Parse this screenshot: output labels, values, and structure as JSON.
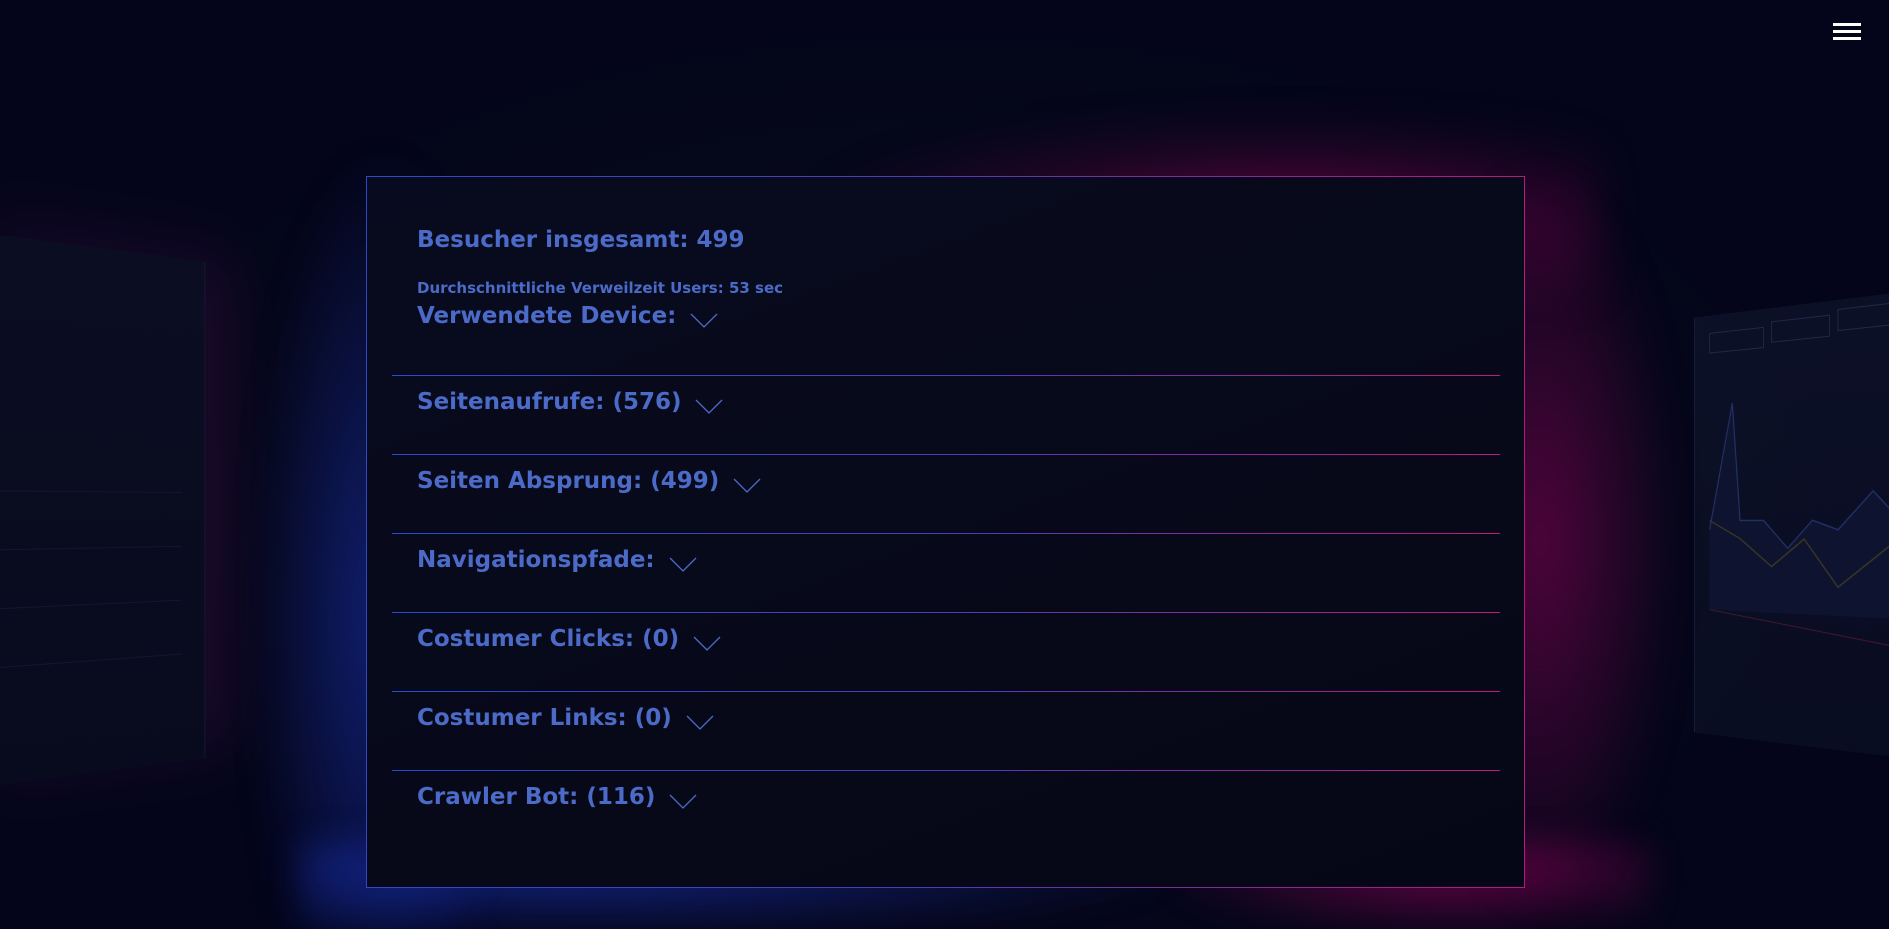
{
  "header": {
    "menu_icon": "hamburger-menu-icon"
  },
  "stats": {
    "total_visitors": "Besucher insgesamt: 499",
    "avg_time": "Durchschnittliche Verweilzeit Users: 53 sec"
  },
  "sections": [
    {
      "label": "Verwendete Device:"
    },
    {
      "label": "Seitenaufrufe: (576)"
    },
    {
      "label": "Seiten Absprung: (499)"
    },
    {
      "label": "Navigationspfade:"
    },
    {
      "label": "Costumer Clicks: (0)"
    },
    {
      "label": "Costumer Links: (0)"
    },
    {
      "label": "Crawler Bot: (116)"
    }
  ],
  "colors": {
    "accent_blue": "#4c6bc8",
    "accent_pink": "#c0197a",
    "background": "#050716"
  }
}
